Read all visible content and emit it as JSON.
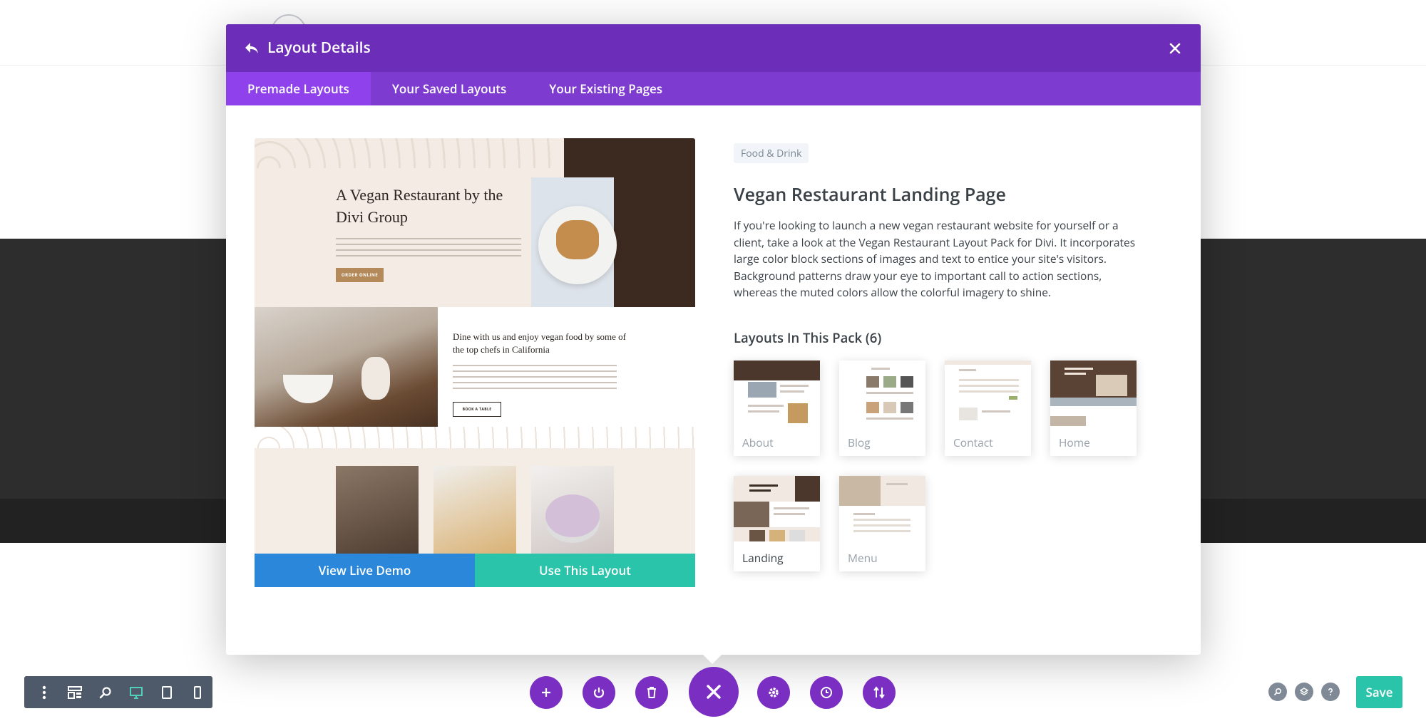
{
  "modal": {
    "title": "Layout Details",
    "tabs": [
      {
        "label": "Premade Layouts",
        "active": true
      },
      {
        "label": "Your Saved Layouts",
        "active": false
      },
      {
        "label": "Your Existing Pages",
        "active": false
      }
    ]
  },
  "preview": {
    "headline": "A Vegan Restaurant by the Divi Group",
    "cta": "ORDER ONLINE",
    "section_heading": "Dine with us and enjoy vegan food by some of the top chefs in California",
    "section_cta": "BOOK A TABLE",
    "view_demo_label": "View Live Demo",
    "use_layout_label": "Use This Layout"
  },
  "details": {
    "category": "Food & Drink",
    "name": "Vegan Restaurant Landing Page",
    "description": "If you're looking to launch a new vegan restaurant website for yourself or a client, take a look at the Vegan Restaurant Layout Pack for Divi. It incorporates large color block sections of images and text to entice your site's visitors. Background patterns draw your eye to important call to action sections, whereas the muted colors allow the colorful imagery to shine.",
    "pack_title": "Layouts In This Pack (6)",
    "layouts": [
      {
        "label": "About"
      },
      {
        "label": "Blog"
      },
      {
        "label": "Contact"
      },
      {
        "label": "Home"
      },
      {
        "label": "Landing",
        "active": true
      },
      {
        "label": "Menu"
      }
    ]
  },
  "toolbar": {
    "save_label": "Save"
  },
  "colors": {
    "header": "#6c2eb9",
    "tabs": "#7e3bd0",
    "active_tab": "#8f42ec",
    "demo_button": "#2b87da",
    "use_button": "#29c4a9",
    "save_button": "#29c4a9",
    "toolbar_circle": "#7b2fc2"
  }
}
